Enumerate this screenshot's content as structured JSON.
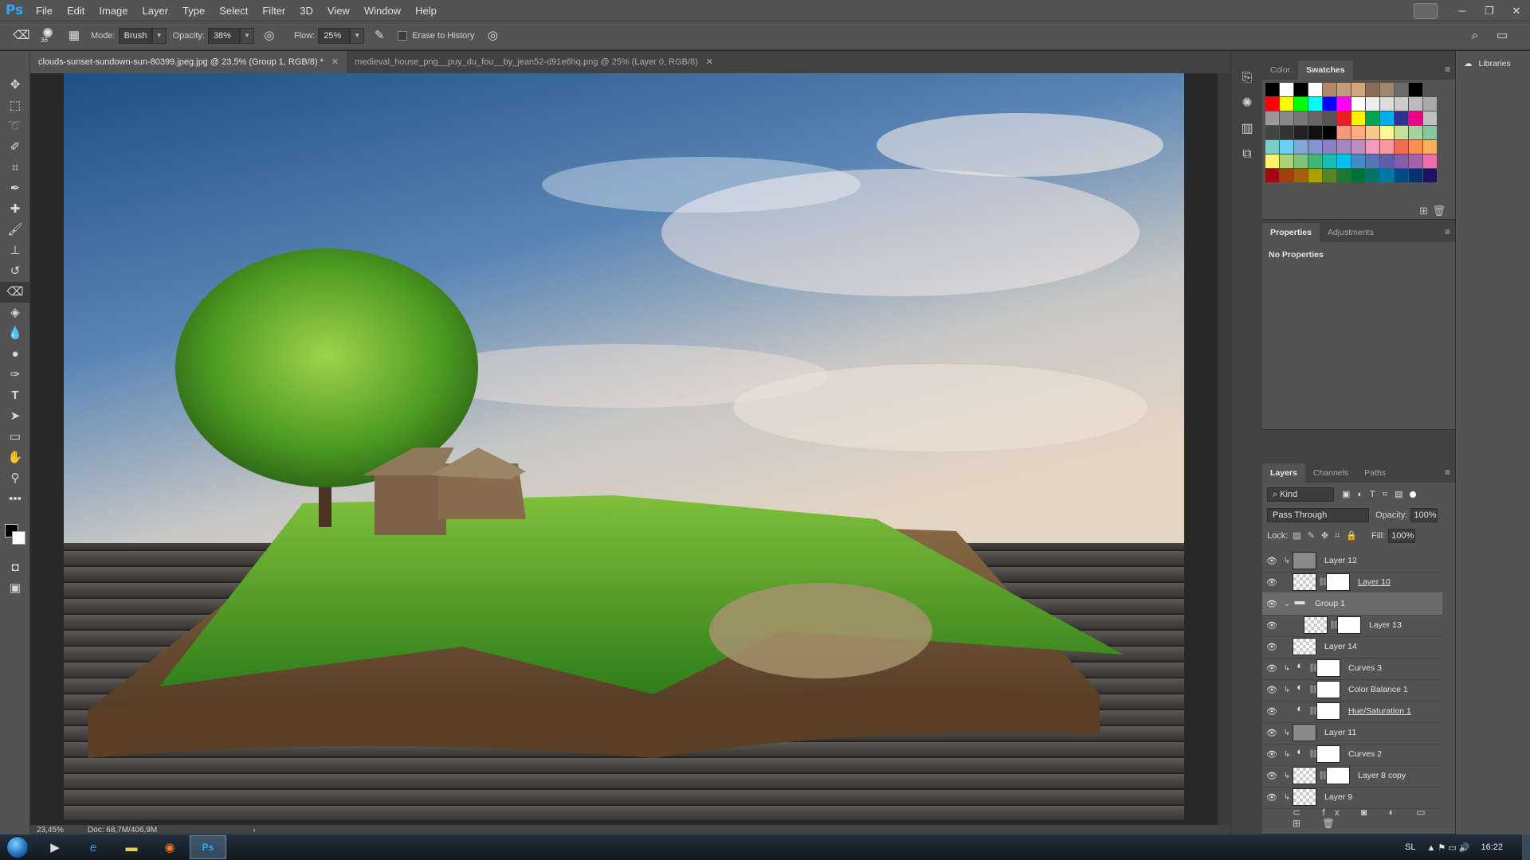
{
  "app": {
    "logo": "Ps"
  },
  "menu": [
    "File",
    "Edit",
    "Image",
    "Layer",
    "Type",
    "Select",
    "Filter",
    "3D",
    "View",
    "Window",
    "Help"
  ],
  "options_bar": {
    "brush_size": "36",
    "mode_label": "Mode:",
    "mode_value": "Brush",
    "opacity_label": "Opacity:",
    "opacity_value": "38%",
    "flow_label": "Flow:",
    "flow_value": "25%",
    "erase_to_history_label": "Erase to History"
  },
  "document_tabs": [
    {
      "title": "clouds-sunset-sundown-sun-80399.jpeg.jpg @ 23,5% (Group 1, RGB/8) *",
      "active": true
    },
    {
      "title": "medieval_house_png__puy_du_fou__by_jean52-d91e6hq.png @ 25% (Layer 0, RGB/8)",
      "active": false
    }
  ],
  "status": {
    "zoom": "23,45%",
    "doc": "Doc: 68,7M/406,9M"
  },
  "swatches_panel": {
    "tabs": [
      "Color",
      "Swatches"
    ],
    "active_tab": "Swatches",
    "rows": [
      [
        "#000000",
        "#ffffff",
        "#000000",
        "#ffffff",
        "#b08866",
        "#c09c78",
        "#d2a57c",
        "#8a6d52",
        "#a08870",
        "#6b6b6b",
        "#000000"
      ],
      [
        "#ff0000",
        "#ffff00",
        "#00ff00",
        "#00ffff",
        "#0000ff",
        "#ff00ff",
        "#ffffff",
        "#eeeeee",
        "#dddddd",
        "#cccccc",
        "#bbbbbb",
        "#aaaaaa"
      ],
      [
        "#999999",
        "#888888",
        "#777777",
        "#666666",
        "#555555",
        "#ed1c24",
        "#fff200",
        "#00a651",
        "#00aeef",
        "#2e3192",
        "#ec008c",
        "#c0c0c0"
      ],
      [
        "#444444",
        "#333333",
        "#222222",
        "#111111",
        "#000000",
        "#f7977a",
        "#f9ad81",
        "#fdc68a",
        "#fff79a",
        "#c4df9b",
        "#a3d39c",
        "#82ca9d"
      ],
      [
        "#7bcdc8",
        "#6ecff6",
        "#7ea7d8",
        "#8493ca",
        "#8882be",
        "#a187be",
        "#bc8dbf",
        "#f49ac2",
        "#f6989d",
        "#f26c4f",
        "#f68e55",
        "#fbaf5c"
      ],
      [
        "#fff467",
        "#acd372",
        "#7cc576",
        "#3bb878",
        "#1abbb4",
        "#00bff3",
        "#438ccb",
        "#5574b9",
        "#605ca8",
        "#855fa8",
        "#a763a8",
        "#f06eaa"
      ],
      [
        "#9e0b0f",
        "#a0410d",
        "#a36209",
        "#aba000",
        "#598527",
        "#1a7b30",
        "#007236",
        "#00746b",
        "#0076a3",
        "#004b80",
        "#003471",
        "#1b1464"
      ]
    ]
  },
  "properties_panel": {
    "tabs": [
      "Properties",
      "Adjustments"
    ],
    "active_tab": "Properties",
    "body": "No Properties"
  },
  "layers_panel": {
    "tabs": [
      "Layers",
      "Channels",
      "Paths"
    ],
    "active_tab": "Layers",
    "kind": "Kind",
    "blend_mode": "Pass Through",
    "opacity_label": "Opacity:",
    "opacity_value": "100%",
    "lock_label": "Lock:",
    "fill_label": "Fill:",
    "fill_value": "100%",
    "layers": [
      {
        "name": "Layer 12",
        "clip": true,
        "thumb": "gray",
        "mask": false,
        "adj": false,
        "underline": false,
        "selected": false,
        "group": false,
        "indent": false
      },
      {
        "name": "Layer 10",
        "clip": false,
        "thumb": "checker",
        "mask": true,
        "adj": false,
        "underline": true,
        "selected": false,
        "group": false,
        "indent": false
      },
      {
        "name": "Group 1",
        "clip": false,
        "thumb": "folder",
        "mask": false,
        "adj": false,
        "underline": false,
        "selected": true,
        "group": true,
        "indent": false
      },
      {
        "name": "Layer 13",
        "clip": false,
        "thumb": "checker",
        "mask": true,
        "adj": false,
        "underline": false,
        "selected": false,
        "group": false,
        "indent": true
      },
      {
        "name": "Layer 14",
        "clip": false,
        "thumb": "checker",
        "mask": false,
        "adj": false,
        "underline": false,
        "selected": false,
        "group": false,
        "indent": false
      },
      {
        "name": "Curves 3",
        "clip": true,
        "thumb": "adj",
        "mask": true,
        "adj": true,
        "underline": false,
        "selected": false,
        "group": false,
        "indent": false
      },
      {
        "name": "Color Balance 1",
        "clip": true,
        "thumb": "adj",
        "mask": true,
        "adj": true,
        "underline": false,
        "selected": false,
        "group": false,
        "indent": false
      },
      {
        "name": "Hue/Saturation 1",
        "clip": false,
        "thumb": "adj",
        "mask": true,
        "adj": true,
        "underline": true,
        "selected": false,
        "group": false,
        "indent": false
      },
      {
        "name": "Layer 11",
        "clip": true,
        "thumb": "gray",
        "mask": false,
        "adj": false,
        "underline": false,
        "selected": false,
        "group": false,
        "indent": false
      },
      {
        "name": "Curves 2",
        "clip": true,
        "thumb": "adj",
        "mask": true,
        "adj": true,
        "underline": false,
        "selected": false,
        "group": false,
        "indent": false
      },
      {
        "name": "Layer 8 copy",
        "clip": true,
        "thumb": "checker",
        "mask": true,
        "adj": false,
        "underline": false,
        "selected": false,
        "group": false,
        "indent": false
      },
      {
        "name": "Layer 9",
        "clip": true,
        "thumb": "checker",
        "mask": false,
        "adj": false,
        "underline": false,
        "selected": false,
        "group": false,
        "indent": false
      }
    ]
  },
  "libraries": {
    "label": "Libraries"
  },
  "taskbar": {
    "language": "SL",
    "clock": "16:22"
  }
}
